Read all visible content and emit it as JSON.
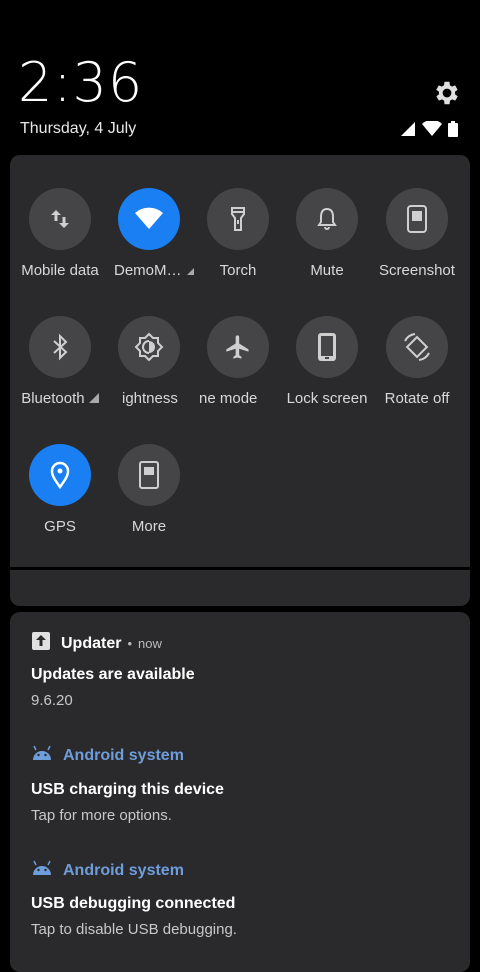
{
  "status": {
    "time": "2:36",
    "date": "Thursday, 4 July",
    "settings_icon": "gear-icon",
    "signal_icon": "cell-signal-icon",
    "wifi_icon": "wifi-icon",
    "battery_icon": "battery-icon"
  },
  "quick_settings": {
    "accent_color": "#1a7ff2",
    "tiles": [
      {
        "label": "Mobile data",
        "icon": "data-transfer-icon",
        "active": false
      },
      {
        "label": "DemoM…",
        "icon": "wifi-icon",
        "active": true
      },
      {
        "label": "Torch",
        "icon": "flashlight-icon",
        "active": false
      },
      {
        "label": "Mute",
        "icon": "bell-icon",
        "active": false
      },
      {
        "label": "Screenshot",
        "icon": "screenshot-icon",
        "active": false
      },
      {
        "label": "Bluetooth",
        "icon": "bluetooth-icon",
        "active": false
      },
      {
        "label": "ightness",
        "icon": "brightness-icon",
        "active": false
      },
      {
        "label": "ne mode",
        "icon": "airplane-icon",
        "active": false
      },
      {
        "label": "Lock screen",
        "icon": "lock-screen-icon",
        "active": false
      },
      {
        "label": "Rotate off",
        "icon": "rotate-icon",
        "active": false
      },
      {
        "label": "GPS",
        "icon": "location-pin-icon",
        "active": true
      },
      {
        "label": "More",
        "icon": "more-icon",
        "active": false
      }
    ]
  },
  "notifications": [
    {
      "app": "Updater",
      "time": "now",
      "title": "Updates are available",
      "text": "9.6.20",
      "app_color": "#ffffff"
    },
    {
      "app": "Android system",
      "title": "USB charging this device",
      "text": "Tap for more options.",
      "app_color": "#6e9ddb"
    },
    {
      "app": "Android system",
      "title": "USB debugging connected",
      "text": "Tap to disable USB debugging.",
      "app_color": "#6e9ddb"
    }
  ]
}
